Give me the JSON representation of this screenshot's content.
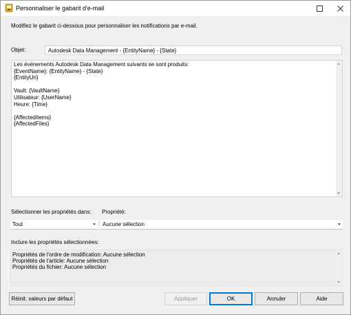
{
  "window": {
    "title": "Personnaliser le gabarit d'e-mail",
    "colors": {
      "accent": "#0078d7",
      "icon": "#d9a520"
    }
  },
  "description": "Modifiez le gabarit ci-dessous pour personnaliser les notifications par e-mail.",
  "subject": {
    "label": "Objet:",
    "value": "Autodesk Data Management - {EntityName} - {State}"
  },
  "body": {
    "text": "Les événements Autodesk Data Management suivants se sont produits:\n{EventName}: {EntityName} - {State}\n{EntityUri}\n\nVault: {VaultName}\nUtilisateur: {UserName}\nHeure: {Time}\n\n{AffectedItems}\n{AffectedFiles}"
  },
  "properties": {
    "select_label": "Sélectionner les propriétés dans:",
    "select_value": "Tout",
    "property_label": "Propriété:",
    "property_value": "Aucune sélection",
    "included_label": "Inclure les propriétés sélectionnées:",
    "included": [
      "Propriétés de l'ordre de modification: Aucune sélection",
      "Propriétés de l'article: Aucune sélection",
      "Propriétés du fichier: Aucune sélection"
    ]
  },
  "buttons": {
    "reset": "Réinit. valeurs par défaut",
    "apply": "Appliquer",
    "ok": "OK",
    "cancel": "Annuler",
    "help": "Aide"
  }
}
